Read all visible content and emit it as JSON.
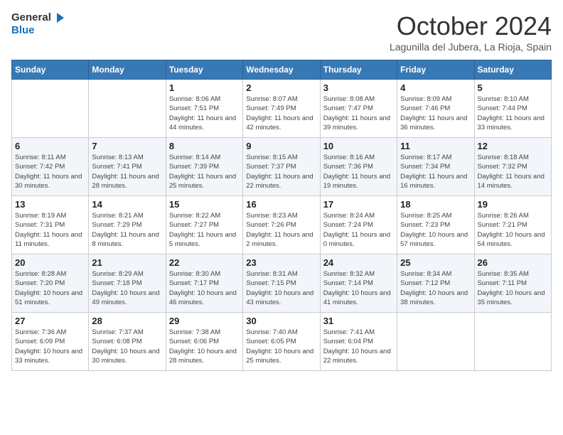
{
  "header": {
    "logo_general": "General",
    "logo_blue": "Blue",
    "month_title": "October 2024",
    "subtitle": "Lagunilla del Jubera, La Rioja, Spain"
  },
  "days_of_week": [
    "Sunday",
    "Monday",
    "Tuesday",
    "Wednesday",
    "Thursday",
    "Friday",
    "Saturday"
  ],
  "weeks": [
    [
      {
        "day": "",
        "sunrise": "",
        "sunset": "",
        "daylight": ""
      },
      {
        "day": "",
        "sunrise": "",
        "sunset": "",
        "daylight": ""
      },
      {
        "day": "1",
        "sunrise": "Sunrise: 8:06 AM",
        "sunset": "Sunset: 7:51 PM",
        "daylight": "Daylight: 11 hours and 44 minutes."
      },
      {
        "day": "2",
        "sunrise": "Sunrise: 8:07 AM",
        "sunset": "Sunset: 7:49 PM",
        "daylight": "Daylight: 11 hours and 42 minutes."
      },
      {
        "day": "3",
        "sunrise": "Sunrise: 8:08 AM",
        "sunset": "Sunset: 7:47 PM",
        "daylight": "Daylight: 11 hours and 39 minutes."
      },
      {
        "day": "4",
        "sunrise": "Sunrise: 8:09 AM",
        "sunset": "Sunset: 7:46 PM",
        "daylight": "Daylight: 11 hours and 36 minutes."
      },
      {
        "day": "5",
        "sunrise": "Sunrise: 8:10 AM",
        "sunset": "Sunset: 7:44 PM",
        "daylight": "Daylight: 11 hours and 33 minutes."
      }
    ],
    [
      {
        "day": "6",
        "sunrise": "Sunrise: 8:11 AM",
        "sunset": "Sunset: 7:42 PM",
        "daylight": "Daylight: 11 hours and 30 minutes."
      },
      {
        "day": "7",
        "sunrise": "Sunrise: 8:13 AM",
        "sunset": "Sunset: 7:41 PM",
        "daylight": "Daylight: 11 hours and 28 minutes."
      },
      {
        "day": "8",
        "sunrise": "Sunrise: 8:14 AM",
        "sunset": "Sunset: 7:39 PM",
        "daylight": "Daylight: 11 hours and 25 minutes."
      },
      {
        "day": "9",
        "sunrise": "Sunrise: 8:15 AM",
        "sunset": "Sunset: 7:37 PM",
        "daylight": "Daylight: 11 hours and 22 minutes."
      },
      {
        "day": "10",
        "sunrise": "Sunrise: 8:16 AM",
        "sunset": "Sunset: 7:36 PM",
        "daylight": "Daylight: 11 hours and 19 minutes."
      },
      {
        "day": "11",
        "sunrise": "Sunrise: 8:17 AM",
        "sunset": "Sunset: 7:34 PM",
        "daylight": "Daylight: 11 hours and 16 minutes."
      },
      {
        "day": "12",
        "sunrise": "Sunrise: 8:18 AM",
        "sunset": "Sunset: 7:32 PM",
        "daylight": "Daylight: 11 hours and 14 minutes."
      }
    ],
    [
      {
        "day": "13",
        "sunrise": "Sunrise: 8:19 AM",
        "sunset": "Sunset: 7:31 PM",
        "daylight": "Daylight: 11 hours and 11 minutes."
      },
      {
        "day": "14",
        "sunrise": "Sunrise: 8:21 AM",
        "sunset": "Sunset: 7:29 PM",
        "daylight": "Daylight: 11 hours and 8 minutes."
      },
      {
        "day": "15",
        "sunrise": "Sunrise: 8:22 AM",
        "sunset": "Sunset: 7:27 PM",
        "daylight": "Daylight: 11 hours and 5 minutes."
      },
      {
        "day": "16",
        "sunrise": "Sunrise: 8:23 AM",
        "sunset": "Sunset: 7:26 PM",
        "daylight": "Daylight: 11 hours and 2 minutes."
      },
      {
        "day": "17",
        "sunrise": "Sunrise: 8:24 AM",
        "sunset": "Sunset: 7:24 PM",
        "daylight": "Daylight: 11 hours and 0 minutes."
      },
      {
        "day": "18",
        "sunrise": "Sunrise: 8:25 AM",
        "sunset": "Sunset: 7:23 PM",
        "daylight": "Daylight: 10 hours and 57 minutes."
      },
      {
        "day": "19",
        "sunrise": "Sunrise: 8:26 AM",
        "sunset": "Sunset: 7:21 PM",
        "daylight": "Daylight: 10 hours and 54 minutes."
      }
    ],
    [
      {
        "day": "20",
        "sunrise": "Sunrise: 8:28 AM",
        "sunset": "Sunset: 7:20 PM",
        "daylight": "Daylight: 10 hours and 51 minutes."
      },
      {
        "day": "21",
        "sunrise": "Sunrise: 8:29 AM",
        "sunset": "Sunset: 7:18 PM",
        "daylight": "Daylight: 10 hours and 49 minutes."
      },
      {
        "day": "22",
        "sunrise": "Sunrise: 8:30 AM",
        "sunset": "Sunset: 7:17 PM",
        "daylight": "Daylight: 10 hours and 46 minutes."
      },
      {
        "day": "23",
        "sunrise": "Sunrise: 8:31 AM",
        "sunset": "Sunset: 7:15 PM",
        "daylight": "Daylight: 10 hours and 43 minutes."
      },
      {
        "day": "24",
        "sunrise": "Sunrise: 8:32 AM",
        "sunset": "Sunset: 7:14 PM",
        "daylight": "Daylight: 10 hours and 41 minutes."
      },
      {
        "day": "25",
        "sunrise": "Sunrise: 8:34 AM",
        "sunset": "Sunset: 7:12 PM",
        "daylight": "Daylight: 10 hours and 38 minutes."
      },
      {
        "day": "26",
        "sunrise": "Sunrise: 8:35 AM",
        "sunset": "Sunset: 7:11 PM",
        "daylight": "Daylight: 10 hours and 35 minutes."
      }
    ],
    [
      {
        "day": "27",
        "sunrise": "Sunrise: 7:36 AM",
        "sunset": "Sunset: 6:09 PM",
        "daylight": "Daylight: 10 hours and 33 minutes."
      },
      {
        "day": "28",
        "sunrise": "Sunrise: 7:37 AM",
        "sunset": "Sunset: 6:08 PM",
        "daylight": "Daylight: 10 hours and 30 minutes."
      },
      {
        "day": "29",
        "sunrise": "Sunrise: 7:38 AM",
        "sunset": "Sunset: 6:06 PM",
        "daylight": "Daylight: 10 hours and 28 minutes."
      },
      {
        "day": "30",
        "sunrise": "Sunrise: 7:40 AM",
        "sunset": "Sunset: 6:05 PM",
        "daylight": "Daylight: 10 hours and 25 minutes."
      },
      {
        "day": "31",
        "sunrise": "Sunrise: 7:41 AM",
        "sunset": "Sunset: 6:04 PM",
        "daylight": "Daylight: 10 hours and 22 minutes."
      },
      {
        "day": "",
        "sunrise": "",
        "sunset": "",
        "daylight": ""
      },
      {
        "day": "",
        "sunrise": "",
        "sunset": "",
        "daylight": ""
      }
    ]
  ]
}
